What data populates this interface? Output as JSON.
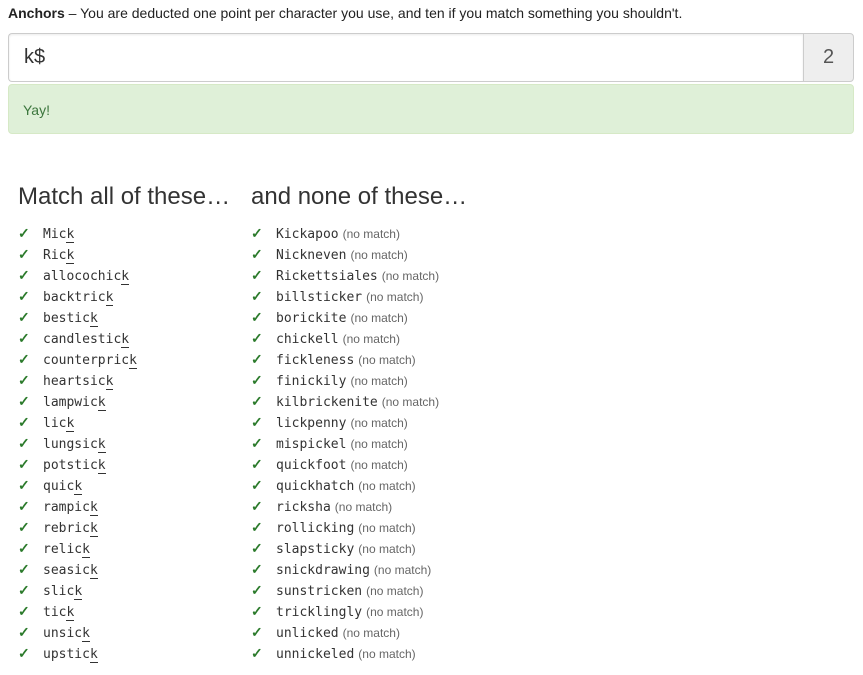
{
  "header": {
    "title": "Anchors",
    "text": " – You are deducted one point per character you use, and ten if you match something you shouldn't."
  },
  "input": {
    "value": "k$"
  },
  "score": "2",
  "status": {
    "message": "Yay!"
  },
  "match": {
    "heading": "Match all of these…",
    "check_icon": "✓",
    "items": [
      {
        "pre": "Mic",
        "hl": "k"
      },
      {
        "pre": "Ric",
        "hl": "k"
      },
      {
        "pre": "allocochic",
        "hl": "k"
      },
      {
        "pre": "backtric",
        "hl": "k"
      },
      {
        "pre": "bestic",
        "hl": "k"
      },
      {
        "pre": "candlestic",
        "hl": "k"
      },
      {
        "pre": "counterpric",
        "hl": "k"
      },
      {
        "pre": "heartsic",
        "hl": "k"
      },
      {
        "pre": "lampwic",
        "hl": "k"
      },
      {
        "pre": "lic",
        "hl": "k"
      },
      {
        "pre": "lungsic",
        "hl": "k"
      },
      {
        "pre": "potstic",
        "hl": "k"
      },
      {
        "pre": "quic",
        "hl": "k"
      },
      {
        "pre": "rampic",
        "hl": "k"
      },
      {
        "pre": "rebric",
        "hl": "k"
      },
      {
        "pre": "relic",
        "hl": "k"
      },
      {
        "pre": "seasic",
        "hl": "k"
      },
      {
        "pre": "slic",
        "hl": "k"
      },
      {
        "pre": "tic",
        "hl": "k"
      },
      {
        "pre": "unsic",
        "hl": "k"
      },
      {
        "pre": "upstic",
        "hl": "k"
      }
    ]
  },
  "nomatch": {
    "heading": "and none of these…",
    "check_icon": "✓",
    "label": "(no match)",
    "items": [
      "Kickapoo",
      "Nickneven",
      "Rickettsiales",
      "billsticker",
      "borickite",
      "chickell",
      "fickleness",
      "finickily",
      "kilbrickenite",
      "lickpenny",
      "mispickel",
      "quickfoot",
      "quickhatch",
      "ricksha",
      "rollicking",
      "slapsticky",
      "snickdrawing",
      "sunstricken",
      "tricklingly",
      "unlicked",
      "unnickeled"
    ]
  }
}
